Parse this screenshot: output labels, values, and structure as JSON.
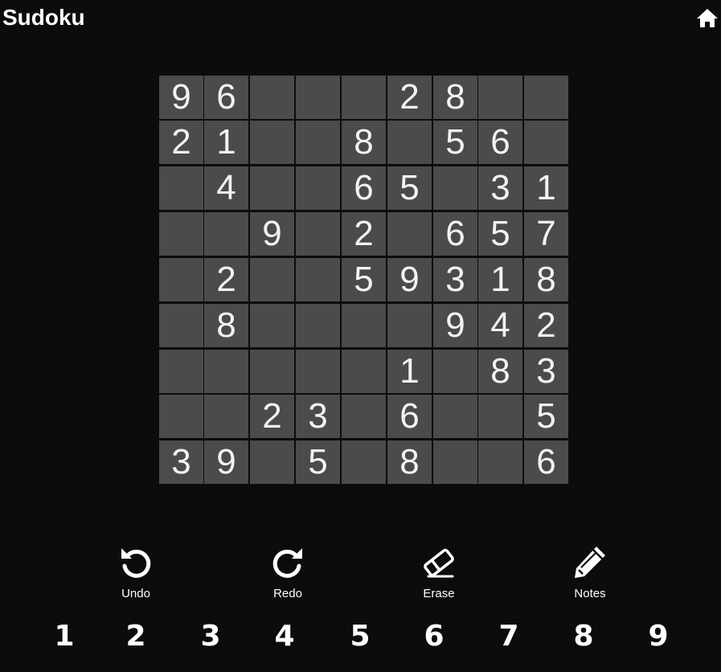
{
  "header": {
    "title": "Sudoku",
    "home_icon": "home-icon"
  },
  "board": {
    "rows": [
      [
        "9",
        "6",
        "",
        "",
        "",
        "2",
        "8",
        "",
        ""
      ],
      [
        "2",
        "1",
        "",
        "",
        "8",
        "",
        "5",
        "6",
        ""
      ],
      [
        "",
        "4",
        "",
        "",
        "6",
        "5",
        "",
        "3",
        "1"
      ],
      [
        "",
        "",
        "9",
        "",
        "2",
        "",
        "6",
        "5",
        "7"
      ],
      [
        "",
        "2",
        "",
        "",
        "5",
        "9",
        "3",
        "1",
        "8"
      ],
      [
        "",
        "8",
        "",
        "",
        "",
        "",
        "9",
        "4",
        "2"
      ],
      [
        "",
        "",
        "",
        "",
        "",
        "1",
        "",
        "8",
        "3"
      ],
      [
        "",
        "",
        "2",
        "3",
        "",
        "6",
        "",
        "",
        "5"
      ],
      [
        "3",
        "9",
        "",
        "5",
        "",
        "8",
        "",
        "",
        "6"
      ]
    ],
    "cell_color": "#4b4b4b",
    "background_color": "#0c0c0c"
  },
  "tools": [
    {
      "id": "undo",
      "label": "Undo",
      "icon": "undo-icon"
    },
    {
      "id": "redo",
      "label": "Redo",
      "icon": "redo-icon"
    },
    {
      "id": "erase",
      "label": "Erase",
      "icon": "eraser-icon"
    },
    {
      "id": "notes",
      "label": "Notes",
      "icon": "pencil-icon"
    }
  ],
  "numpad": [
    "1",
    "2",
    "3",
    "4",
    "5",
    "6",
    "7",
    "8",
    "9"
  ]
}
